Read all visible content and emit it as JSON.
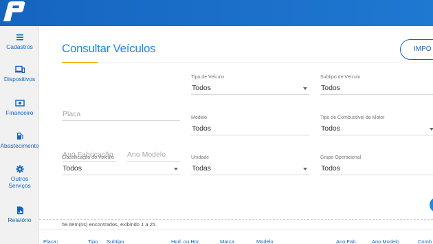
{
  "brand": {
    "logo_color": "#1565c0",
    "topbar_color": "#1f78d1",
    "accent_color": "#f4b400"
  },
  "sidebar": {
    "items": [
      {
        "label": "Cadastros",
        "icon": "menu-icon"
      },
      {
        "label": "Dispositivos",
        "icon": "devices-icon"
      },
      {
        "label": "Financeiro",
        "icon": "money-icon"
      },
      {
        "label": "Abastecimento",
        "icon": "fuel-pump-icon"
      },
      {
        "label": "Outros Serviços",
        "icon": "gear-icon"
      },
      {
        "label": "Relatório",
        "icon": "report-icon"
      }
    ]
  },
  "page": {
    "title": "Consultar Veículos",
    "import_label": "IMPO"
  },
  "filters": {
    "placa": {
      "placeholder": "Placa"
    },
    "tipo_veiculo": {
      "label": "Tipo de Veículo",
      "value": "Todos"
    },
    "subtipo_veiculo": {
      "label": "Subtipo de Veículo",
      "value": "Todos"
    },
    "ano_fabricacao": {
      "placeholder": "Ano Fabricação"
    },
    "ano_modelo": {
      "placeholder": "Ano Modelo"
    },
    "modelo": {
      "label": "Modelo",
      "value": "Todos"
    },
    "tipo_combustivel": {
      "label": "Tipo de Combustível do Motor",
      "value": "Todos"
    },
    "classificacao": {
      "label": "Classificação do Veículo",
      "value": "Todos"
    },
    "unidade": {
      "label": "Unidade",
      "value": "Todas"
    },
    "grupo_operacional": {
      "label": "Grupo Operacional",
      "value": "Todos"
    }
  },
  "results": {
    "summary": "59 item(ns) encontrados, exibindo 1 a 25."
  },
  "table": {
    "columns": [
      "Placa↑",
      "Tipo",
      "Subtipo",
      "Hod. ou Hor.",
      "Marca",
      "Modelo",
      "Ano Fab.",
      "Ano Modelo",
      "Comb"
    ]
  }
}
